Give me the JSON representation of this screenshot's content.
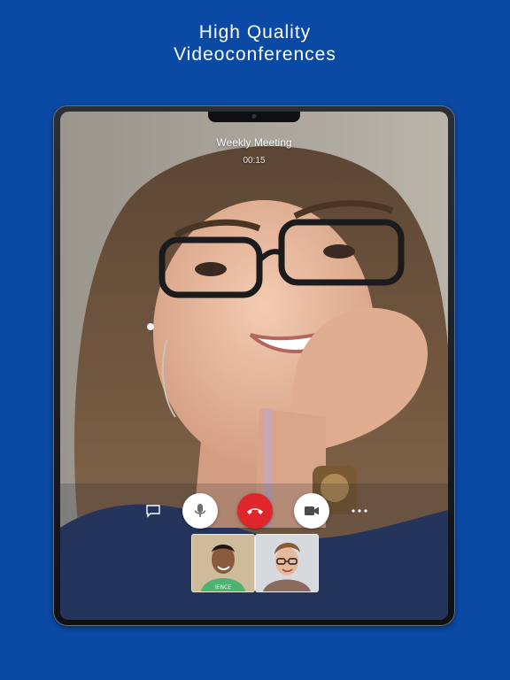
{
  "headline": {
    "line1": "High Quality",
    "line2": "Videoconferences"
  },
  "call": {
    "title": "Weekly Meeting",
    "timer": "00:15"
  },
  "controls": {
    "chat_icon": "chat-bubble-icon",
    "mic_icon": "microphone-icon",
    "hangup_icon": "phone-hangup-icon",
    "video_icon": "video-camera-icon",
    "more_icon": "more-dots-icon"
  },
  "participants": {
    "thumb1_shirt_text": "IENCE"
  },
  "colors": {
    "background": "#0a4aa5",
    "hangup": "#e0262b",
    "control_bg": "#ffffff"
  }
}
